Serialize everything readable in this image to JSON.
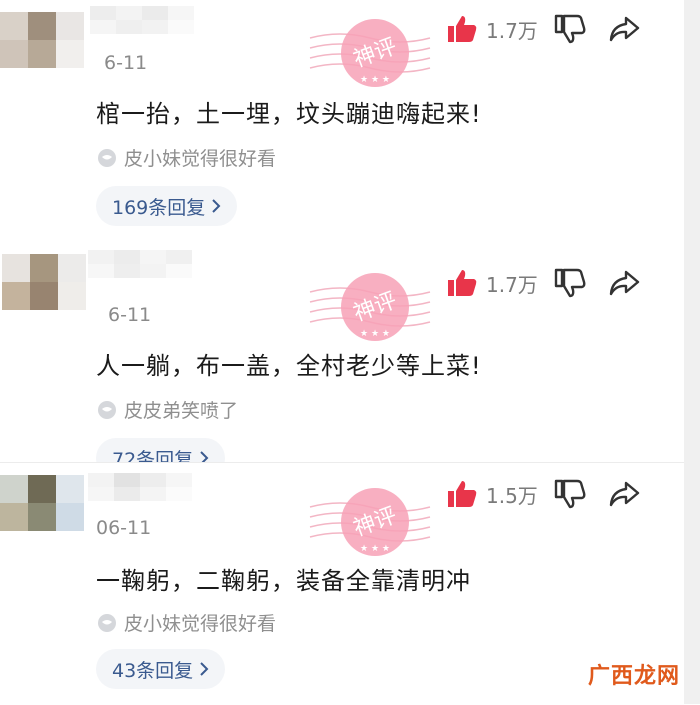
{
  "comments": [
    {
      "date": "6-11",
      "content": "棺一抬，土一埋，坟头蹦迪嗨起来!",
      "liker_text": "皮小妹觉得很好看",
      "likes": "1.7万",
      "reply_text": "169条回复"
    },
    {
      "date": "6-11",
      "content": "人一躺，布一盖，全村老少等上菜!",
      "liker_text": "皮皮弟笑喷了",
      "likes": "1.7万",
      "reply_text": "72条回复"
    },
    {
      "date": "06-11",
      "content": "一鞠躬，二鞠躬，装备全靠清明冲",
      "liker_text": "皮小妹觉得很好看",
      "likes": "1.5万",
      "reply_text": "43条回复"
    }
  ],
  "stamp_text": "神评",
  "watermark": "广西龙网",
  "colors": {
    "like_red": "#e8354a",
    "stamp_pink": "#f06b8b",
    "reply_blue": "#3a5a8f",
    "watermark_orange": "#e05a1c"
  },
  "icons": {
    "like": "thumbs-up-icon",
    "dislike": "thumbs-down-icon",
    "share": "share-arrow-icon",
    "liker": "speech-bubble-icon",
    "reply_more": "chevron-right-icon"
  }
}
